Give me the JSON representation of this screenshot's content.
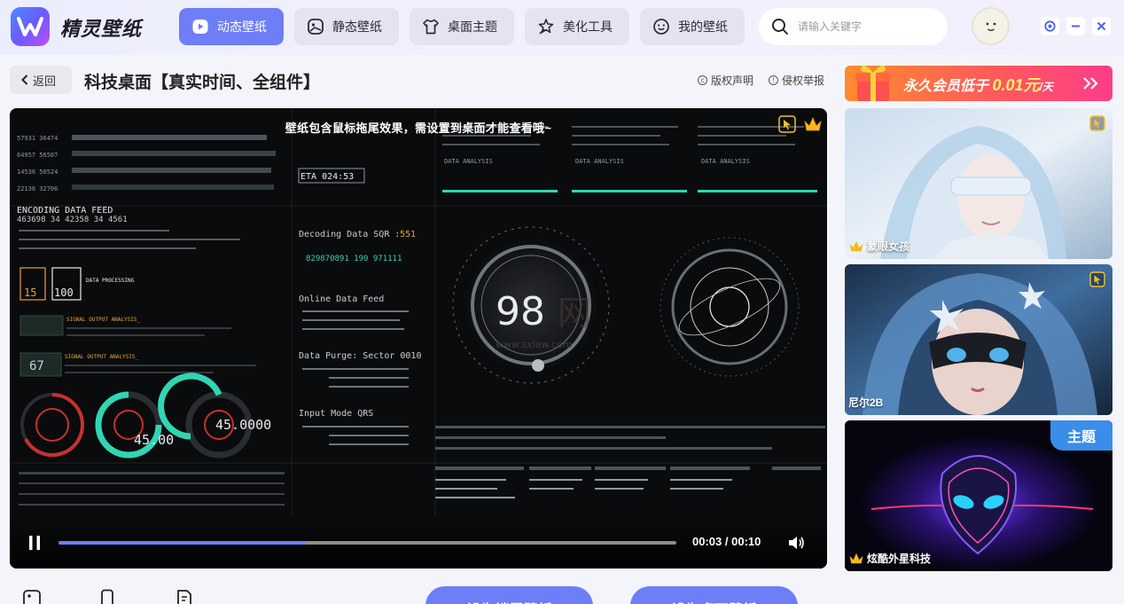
{
  "app": {
    "name": "精灵壁纸"
  },
  "nav": {
    "tabs": [
      {
        "label": "动态壁纸",
        "icon": "video-icon",
        "active": true
      },
      {
        "label": "静态壁纸",
        "icon": "image-icon",
        "active": false
      },
      {
        "label": "桌面主题",
        "icon": "shirt-icon",
        "active": false
      },
      {
        "label": "美化工具",
        "icon": "magic-icon",
        "active": false
      },
      {
        "label": "我的壁纸",
        "icon": "smile-icon",
        "active": false
      }
    ]
  },
  "search": {
    "placeholder": "请输入关键字"
  },
  "header": {
    "back_label": "返回",
    "title": "科技桌面【真实时间、全组件】",
    "copyright_label": "版权声明",
    "report_label": "侵权举报"
  },
  "video": {
    "notice": "壁纸包含鼠标拖尾效果，需设置到桌面才能查看哦~",
    "current_time": "00:03",
    "total_time": "00:10",
    "progress": 0.4,
    "hud_numbers": {
      "center_big": "98",
      "encoding_title": "ENCODING DATA FEED",
      "encoding_nums": "463698   34  42358   34   4561",
      "gauge_a": "45.00",
      "gauge_b": "45.0000",
      "side_num": "67",
      "eta": "ETA 024:53",
      "sqr_label": "Decoding Data SQR :",
      "sqr_value": "551",
      "sqr_nums": "829870891 190 971111",
      "online_feed": "Online Data Feed",
      "purge": "Data Purge: Sector 0010",
      "input_mode": "Input Mode QRS",
      "data_processing": "DATA PROCESSING",
      "signal_output": "SIGNAL OUTPUT ANALYSIS_",
      "box_a": "15",
      "box_b": "100",
      "data_analysis": "DATA ANALYSIS",
      "watermark_a": "www.sxiaw.com",
      "watermark_b": "网"
    }
  },
  "sidebar": {
    "vip_banner": {
      "prefix": "永久会员低于 ",
      "price": "0.01元",
      "suffix": "/天"
    },
    "cards": [
      {
        "label": "蒙眼女孩",
        "crown": true,
        "badge": ""
      },
      {
        "label": "尼尔2B",
        "crown": false,
        "badge": ""
      },
      {
        "label": "炫酷外星科技",
        "crown": true,
        "badge": "主题"
      }
    ]
  },
  "actions": {
    "set_lock_label": "设为锁屏壁纸",
    "set_desktop_label": "设为桌面壁纸"
  },
  "colors": {
    "accent": "#6d7ef7",
    "tab_bg": "#e3e4ef",
    "hud_cyan": "#2fd6b4",
    "hud_red": "#c9302c",
    "hud_orange": "#e8a23a",
    "badge_blue": "#3a8de8"
  }
}
